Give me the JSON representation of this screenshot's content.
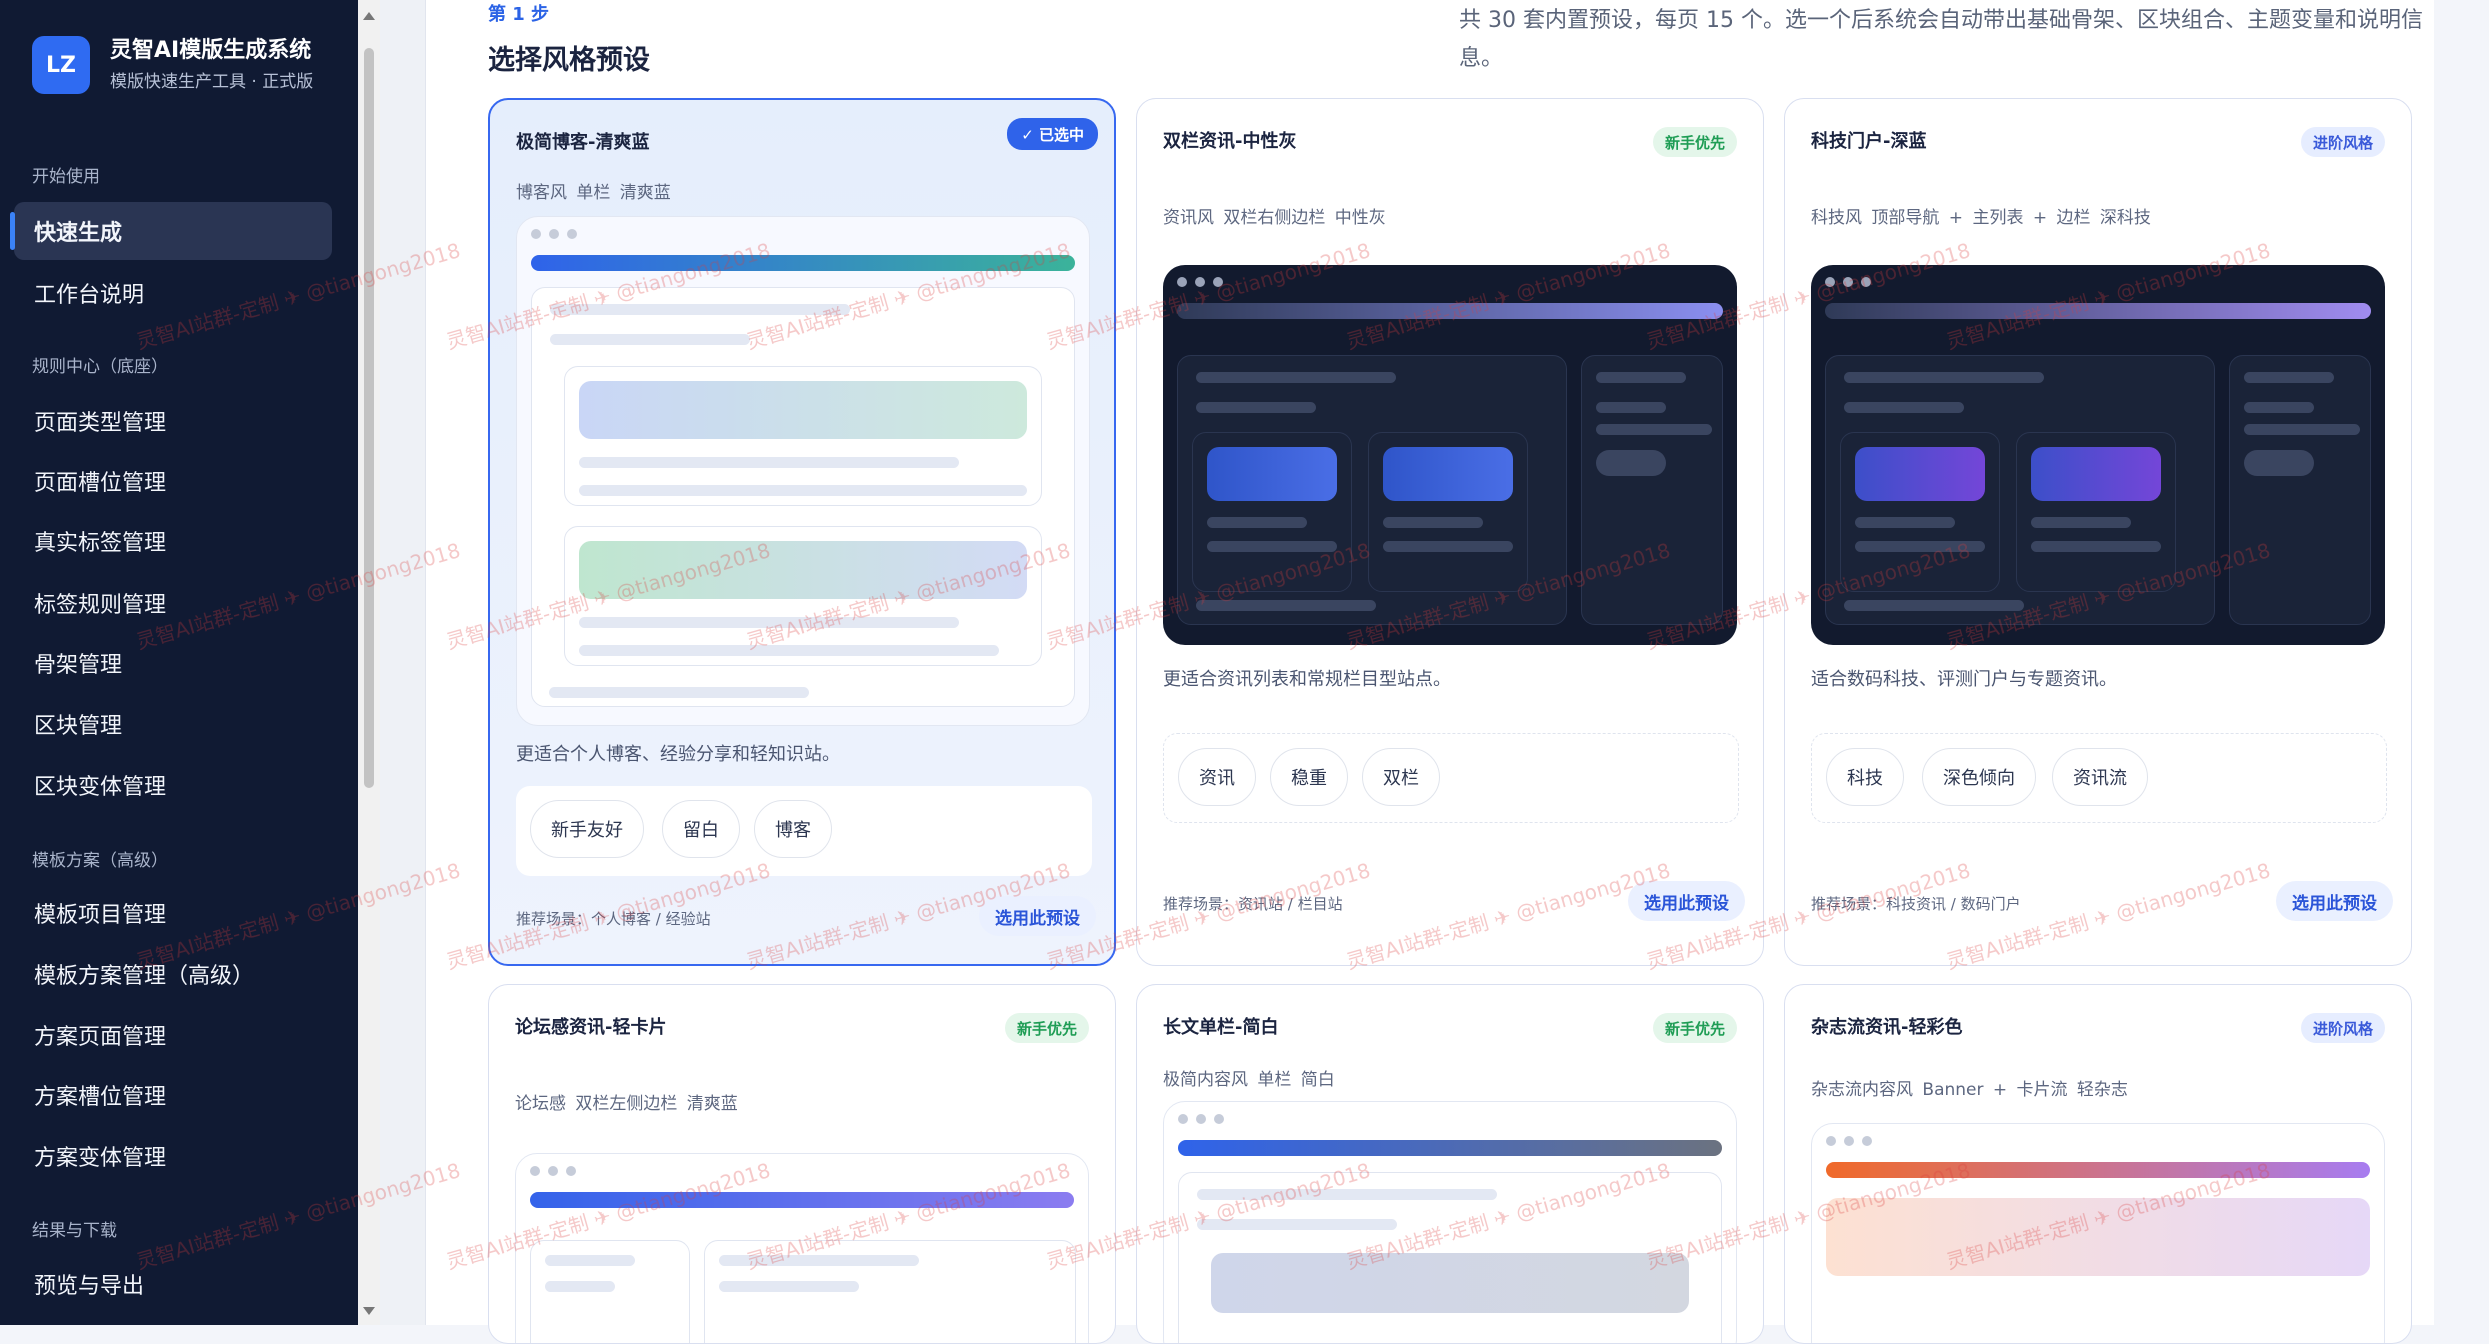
{
  "brand": {
    "logo": "LZ",
    "title": "灵智AI模版生成系统",
    "subtitle": "模版快速生产工具 · 正式版"
  },
  "sidebar": {
    "groups": [
      {
        "label": "开始使用",
        "items": [
          "快速生成",
          "工作台说明"
        ]
      },
      {
        "label": "规则中心（底座）",
        "items": [
          "页面类型管理",
          "页面槽位管理",
          "真实标签管理",
          "标签规则管理",
          "骨架管理",
          "区块管理",
          "区块变体管理"
        ]
      },
      {
        "label": "模板方案（高级）",
        "items": [
          "模板项目管理",
          "模板方案管理（高级）",
          "方案页面管理",
          "方案槽位管理",
          "方案变体管理"
        ]
      },
      {
        "label": "结果与下载",
        "items": [
          "预览与导出"
        ]
      }
    ],
    "active": "快速生成"
  },
  "main": {
    "step": "第 1 步",
    "title": "选择风格预设",
    "description": "共 30 套内置预设，每页 15 个。选一个后系统会自动带出基础骨架、区块组合、主题变量和说明信息。",
    "use_label": "选用此预设",
    "selected_label": "✓ 已选中"
  },
  "cards": [
    {
      "title": "极简博客-清爽蓝",
      "badge": "",
      "tags": "博客风  单栏  清爽蓝",
      "desc": "更适合个人博客、经验分享和轻知识站。",
      "chips": [
        "新手友好",
        "留白",
        "博客"
      ],
      "scene": "推荐场景：个人博客 / 经验站",
      "selected": true
    },
    {
      "title": "双栏资讯-中性灰",
      "badge": "新手优先",
      "tags": "资讯风  双栏右侧边栏  中性灰",
      "desc": "更适合资讯列表和常规栏目型站点。",
      "chips": [
        "资讯",
        "稳重",
        "双栏"
      ],
      "scene": "推荐场景：资讯站 / 栏目站"
    },
    {
      "title": "科技门户-深蓝",
      "badge": "进阶风格",
      "tags": "科技风  顶部导航 + 主列表 + 边栏  深科技",
      "desc": "适合数码科技、评测门户与专题资讯。",
      "chips": [
        "科技",
        "深色倾向",
        "资讯流"
      ],
      "scene": "推荐场景：科技资讯 / 数码门户"
    },
    {
      "title": "论坛感资讯-轻卡片",
      "badge": "新手优先",
      "tags": "论坛感  双栏左侧边栏  清爽蓝"
    },
    {
      "title": "长文单栏-简白",
      "badge": "新手优先",
      "tags": "极简内容风  单栏  简白"
    },
    {
      "title": "杂志流资讯-轻彩色",
      "badge": "进阶风格",
      "tags": "杂志流内容风  Banner + 卡片流  轻杂志"
    }
  ],
  "watermark": "灵智AI站群-定制 ✈ @tiangong2018",
  "colors": {
    "sidebar": "#101a33",
    "accent": "#2f63ea",
    "green": "#1f9d55"
  }
}
